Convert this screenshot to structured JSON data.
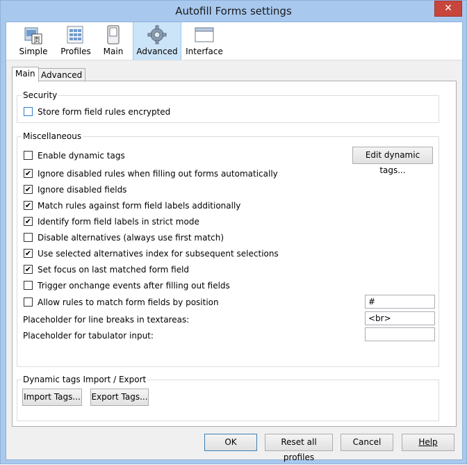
{
  "window": {
    "title": "Autofill Forms settings",
    "close_glyph": "✕"
  },
  "toolbar": {
    "items": [
      {
        "label": "Simple",
        "icon": "simple-page-icon"
      },
      {
        "label": "Profiles",
        "icon": "profiles-grid-icon"
      },
      {
        "label": "Main",
        "icon": "main-switch-icon"
      },
      {
        "label": "Advanced",
        "icon": "gear-icon",
        "selected": true
      },
      {
        "label": "Interface",
        "icon": "window-icon"
      }
    ]
  },
  "tabs": [
    {
      "label": "Main",
      "active": true
    },
    {
      "label": "Advanced"
    }
  ],
  "security": {
    "label": "Security",
    "store_encrypted": {
      "label": "Store form field rules encrypted",
      "checked": false
    }
  },
  "misc": {
    "label": "Miscellaneous",
    "options": [
      {
        "label": "Enable dynamic tags",
        "checked": false
      },
      {
        "label": "Ignore disabled rules when filling out forms automatically",
        "checked": true
      },
      {
        "label": "Ignore disabled fields",
        "checked": true
      },
      {
        "label": "Match rules against form field labels additionally",
        "checked": true
      },
      {
        "label": "Identify form field labels in strict mode",
        "checked": true
      },
      {
        "label": "Disable alternatives (always use first match)",
        "checked": false
      },
      {
        "label": "Use selected alternatives index for subsequent selections",
        "checked": true
      },
      {
        "label": "Set focus on last matched form field",
        "checked": true
      },
      {
        "label": "Trigger onchange events after filling out fields",
        "checked": false
      },
      {
        "label": "Allow rules to match form fields by position",
        "checked": false
      }
    ],
    "edit_dynamic_tags": "Edit dynamic tags...",
    "position_value": "#",
    "linebreak_label": "Placeholder for line breaks in textareas:",
    "linebreak_value": "<br>",
    "tab_label": "Placeholder for tabulator input:",
    "tab_value": ""
  },
  "importexport": {
    "label": "Dynamic tags Import / Export",
    "import": "Import Tags...",
    "export": "Export Tags..."
  },
  "footer": {
    "ok": "OK",
    "reset": "Reset all profiles",
    "cancel": "Cancel",
    "help": "Help"
  },
  "check_glyph": "✔"
}
